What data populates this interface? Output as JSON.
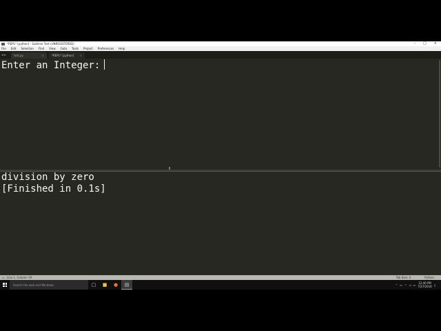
{
  "window": {
    "title": "*REPL* [python] - Sublime Text (UNREGISTERED)",
    "controls": [
      "–",
      "□",
      "×"
    ]
  },
  "menu": [
    "File",
    "Edit",
    "Selection",
    "Find",
    "View",
    "Goto",
    "Tools",
    "Project",
    "Preferences",
    "Help"
  ],
  "tabs": [
    {
      "label": "test.py",
      "active": false
    },
    {
      "label": "*REPL* [python]",
      "active": true
    }
  ],
  "editor": {
    "text": "Enter an Integer:"
  },
  "output": {
    "lines": [
      "division by zero",
      "[Finished in 0.1s]"
    ]
  },
  "status": {
    "position": "Line 1, Column 19",
    "tab_size": "Tab Size: 4",
    "syntax": "Python"
  },
  "taskbar": {
    "search_placeholder": "Search the web and Windows",
    "time": "12:40 PM",
    "date": "7/27/2016"
  }
}
